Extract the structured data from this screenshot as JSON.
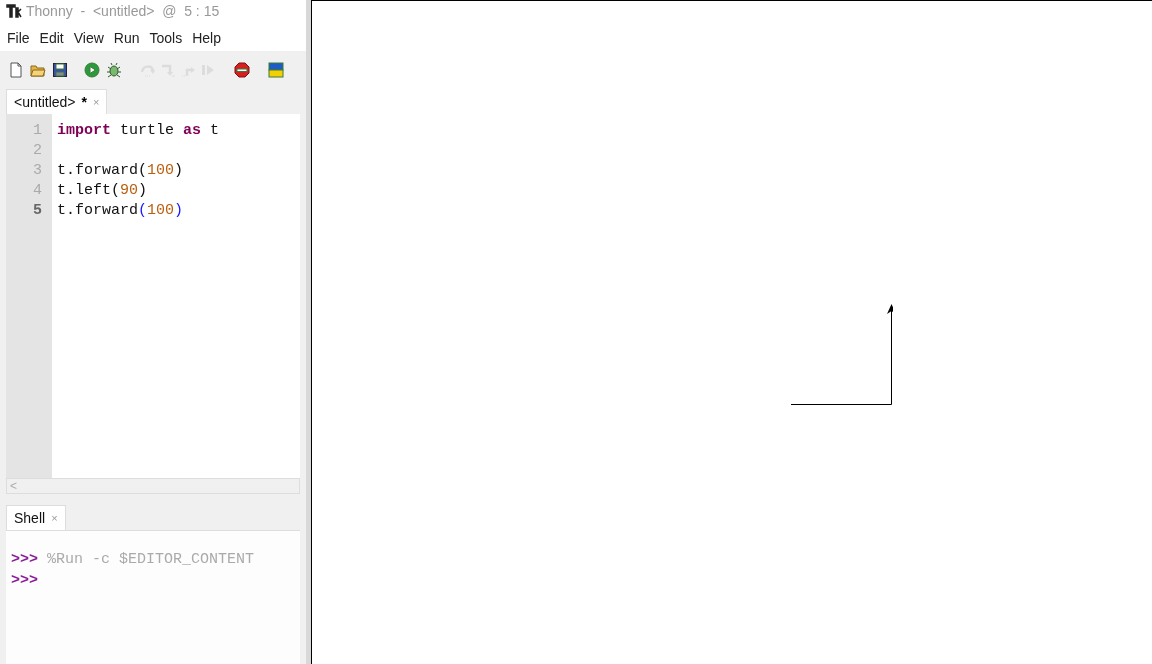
{
  "window": {
    "title": "Thonny  -  <untitled>  @  5 : 15"
  },
  "menu": [
    {
      "label": "File"
    },
    {
      "label": "Edit"
    },
    {
      "label": "View"
    },
    {
      "label": "Run"
    },
    {
      "label": "Tools"
    },
    {
      "label": "Help"
    }
  ],
  "toolbar": [
    {
      "kind": "new",
      "disabled": false
    },
    {
      "kind": "open",
      "disabled": false
    },
    {
      "kind": "save",
      "disabled": false
    },
    {
      "kind": "run",
      "disabled": false
    },
    {
      "kind": "debug",
      "disabled": false
    },
    {
      "kind": "step-over",
      "disabled": true
    },
    {
      "kind": "step-into",
      "disabled": true
    },
    {
      "kind": "step-out",
      "disabled": true
    },
    {
      "kind": "resume",
      "disabled": true
    },
    {
      "kind": "stop",
      "disabled": false
    },
    {
      "kind": "flag",
      "disabled": false
    }
  ],
  "editor": {
    "tab": {
      "label": "<untitled>",
      "modified": "*",
      "close": "×",
      "selected": true
    },
    "lines": [
      {
        "number": "1",
        "current": false,
        "tokens": [
          {
            "kind": "keyword",
            "text": "import"
          },
          {
            "kind": "name",
            "text": " turtle "
          },
          {
            "kind": "keyword",
            "text": "as"
          },
          {
            "kind": "name",
            "text": " t"
          }
        ]
      },
      {
        "number": "2",
        "current": false
      },
      {
        "number": "3",
        "current": false,
        "tokens": [
          {
            "kind": "name",
            "text": "t.forward"
          },
          {
            "kind": "paren",
            "text": "("
          },
          {
            "kind": "number",
            "text": "100"
          },
          {
            "kind": "paren",
            "text": ")"
          }
        ]
      },
      {
        "number": "4",
        "current": false,
        "tokens": [
          {
            "kind": "name",
            "text": "t.left"
          },
          {
            "kind": "paren",
            "text": "("
          },
          {
            "kind": "number",
            "text": "90"
          },
          {
            "kind": "paren",
            "text": ")"
          }
        ]
      },
      {
        "number": "5",
        "current": true,
        "tokens": [
          {
            "kind": "name",
            "text": "t.forward"
          },
          {
            "kind": "matched",
            "text": "("
          },
          {
            "kind": "number",
            "text": "100"
          },
          {
            "kind": "matched",
            "text": ")"
          }
        ]
      }
    ],
    "scroll_arrow": "<"
  },
  "shell": {
    "tab": {
      "label": "Shell",
      "close": "×",
      "selected": true
    },
    "lines": [
      {
        "prompt": ">>>",
        "command": "%Run -c $EDITOR_CONTENT"
      },
      {
        "prompt": ">>>"
      }
    ]
  }
}
